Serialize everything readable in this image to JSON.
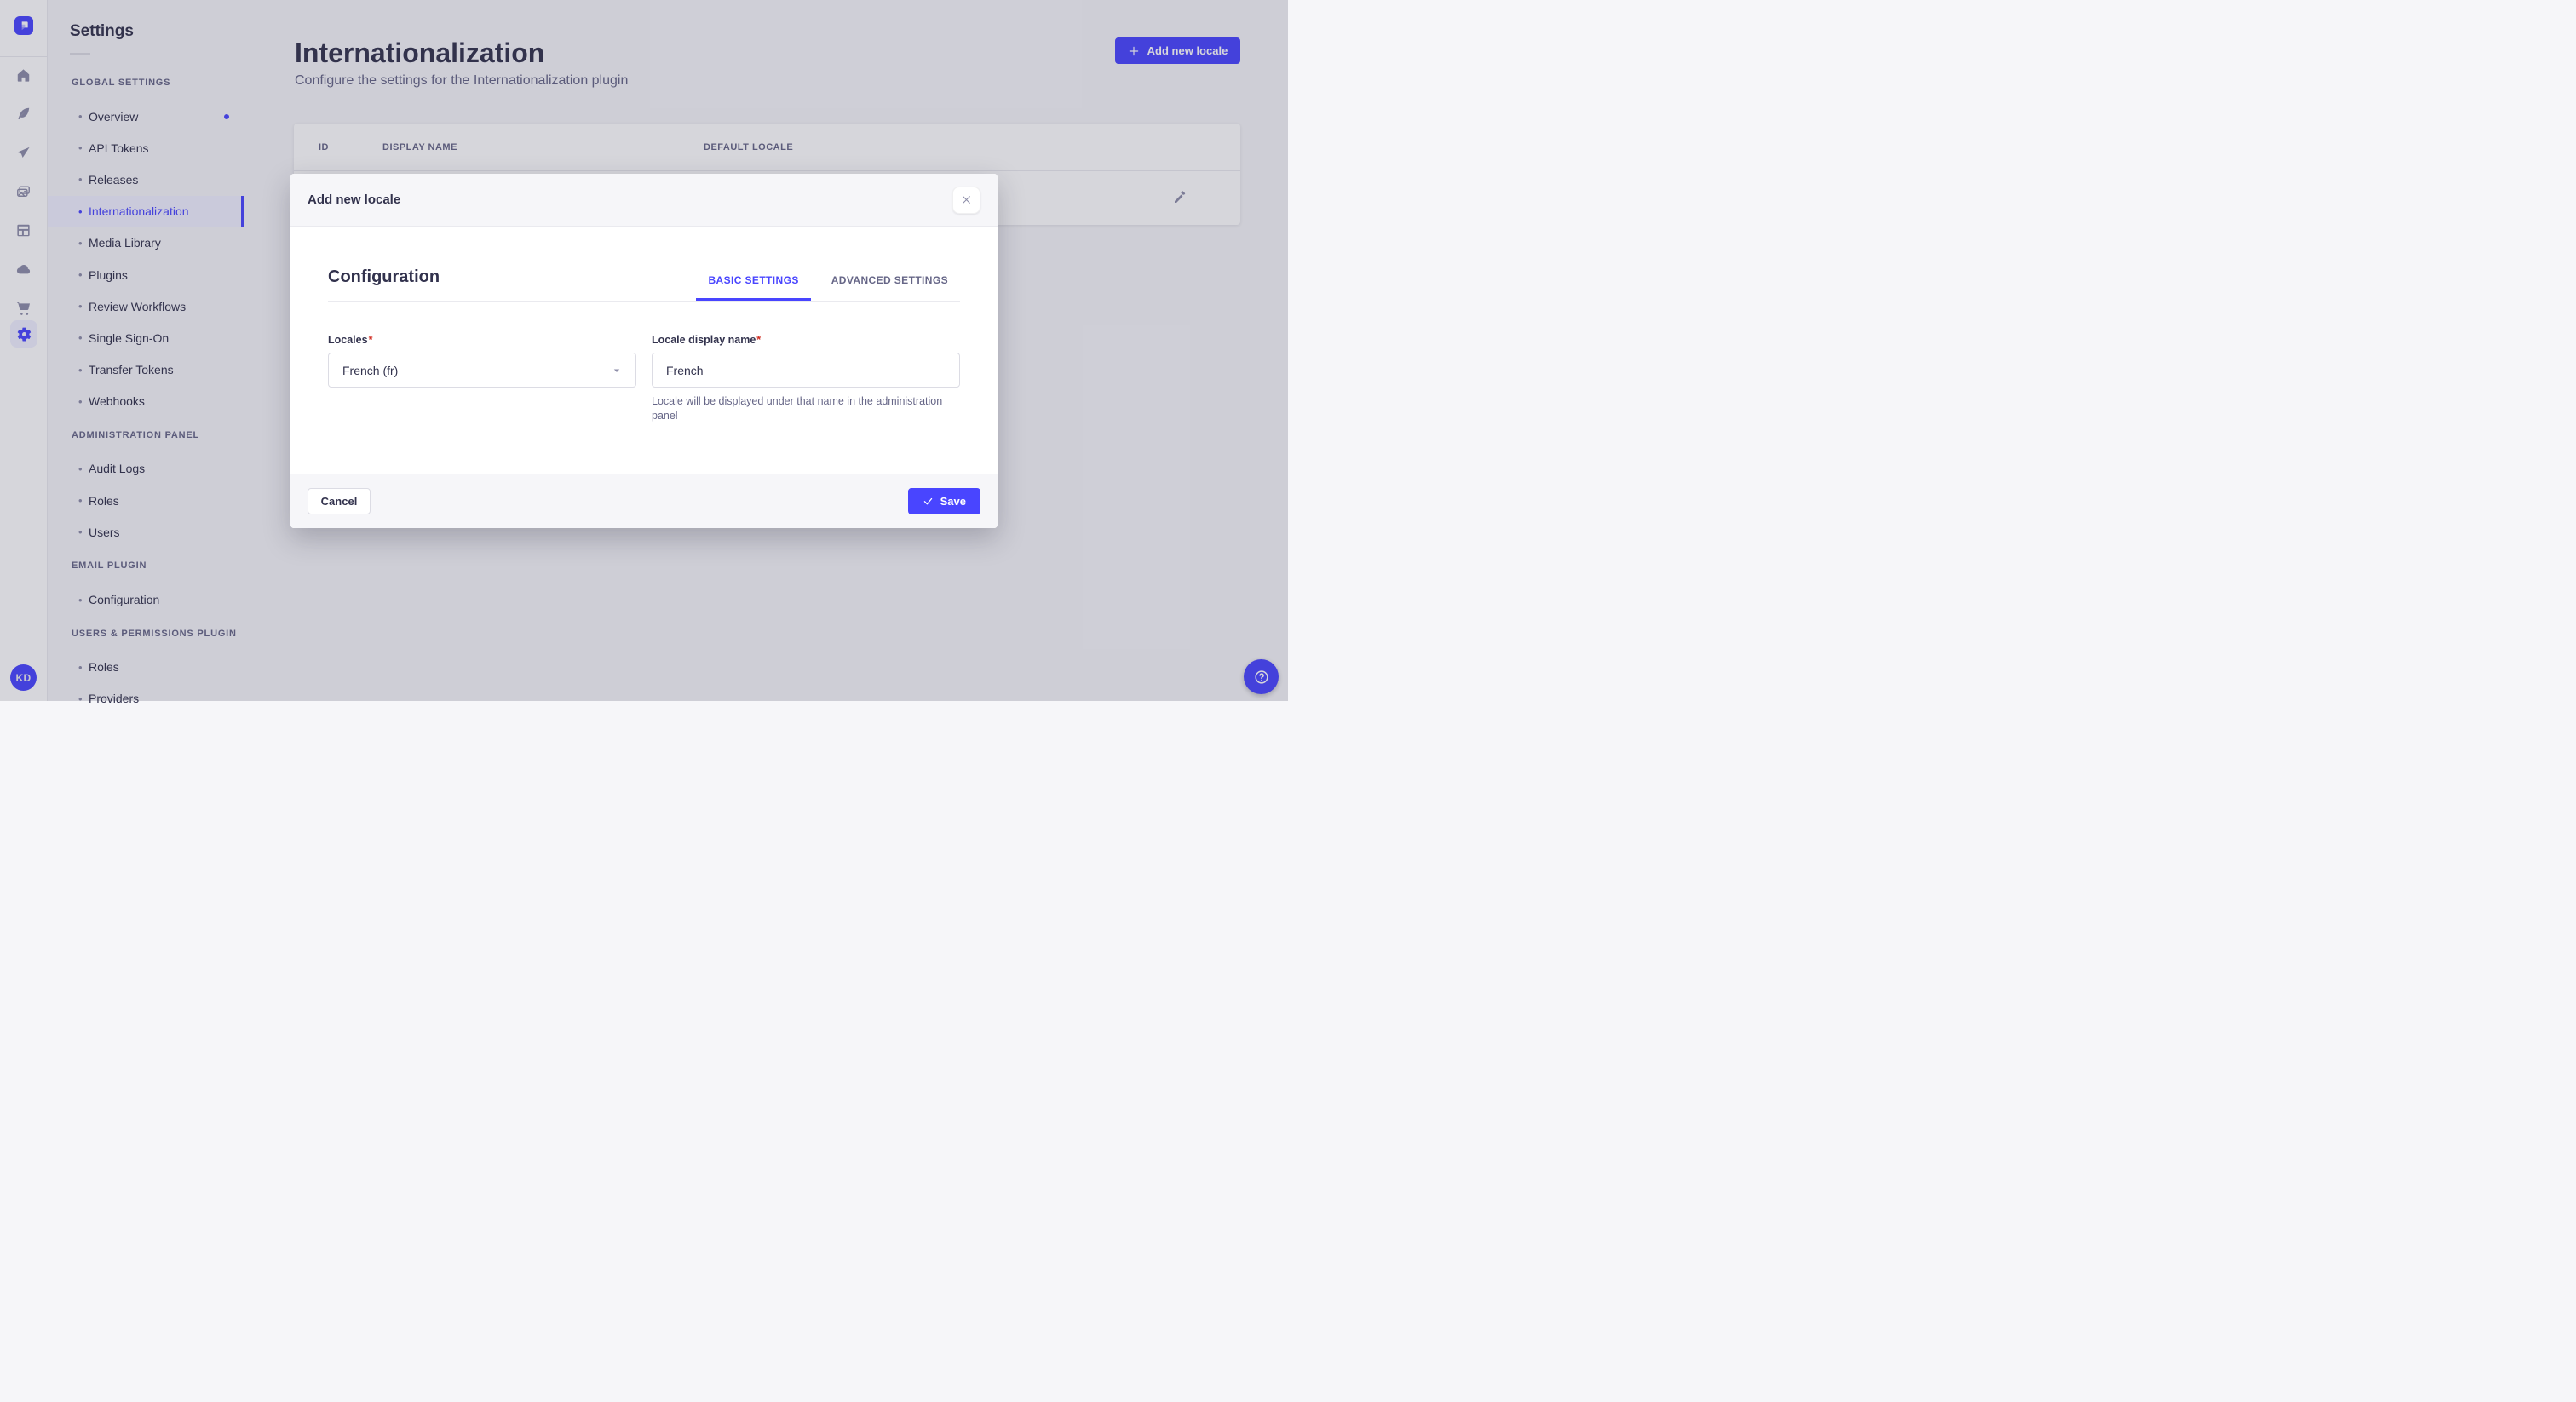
{
  "app": {
    "avatar_initials": "KD",
    "rail_icons": [
      "strapi-logo",
      "home",
      "content-feather",
      "release-paper-plane",
      "media-images",
      "content-manager-layout",
      "cloud",
      "marketplace-cart",
      "settings-gear"
    ],
    "colors": {
      "primary": "#4945ff",
      "text": "#32324d",
      "text_secondary": "#666687",
      "icon_gray": "#8e8ea9",
      "active_bg": "#f0f0ff",
      "surface": "#ffffff",
      "background": "#f6f6f9",
      "required_red": "#d02b20"
    }
  },
  "sidebar": {
    "title": "Settings",
    "sections": [
      {
        "label": "GLOBAL SETTINGS",
        "items": [
          {
            "label": "Overview"
          },
          {
            "label": "API Tokens"
          },
          {
            "label": "Releases"
          },
          {
            "label": "Internationalization"
          },
          {
            "label": "Media Library"
          },
          {
            "label": "Plugins"
          },
          {
            "label": "Review Workflows"
          },
          {
            "label": "Single Sign-On"
          },
          {
            "label": "Transfer Tokens"
          },
          {
            "label": "Webhooks"
          }
        ]
      },
      {
        "label": "ADMINISTRATION PANEL",
        "items": [
          {
            "label": "Audit Logs"
          },
          {
            "label": "Roles"
          },
          {
            "label": "Users"
          }
        ]
      },
      {
        "label": "EMAIL PLUGIN",
        "items": [
          {
            "label": "Configuration"
          }
        ]
      },
      {
        "label": "USERS & PERMISSIONS PLUGIN",
        "items": [
          {
            "label": "Roles"
          },
          {
            "label": "Providers"
          }
        ]
      }
    ]
  },
  "header": {
    "title": "Internationalization",
    "subtitle": "Configure the settings for the Internationalization plugin",
    "add_button_label": "Add new locale"
  },
  "table": {
    "columns": [
      "ID",
      "DISPLAY NAME",
      "DEFAULT LOCALE"
    ]
  },
  "modal": {
    "title": "Add new locale",
    "section_title": "Configuration",
    "required_mark": "*",
    "tabs": [
      {
        "label": "BASIC SETTINGS"
      },
      {
        "label": "ADVANCED SETTINGS"
      }
    ],
    "fields": {
      "locales": {
        "label": "Locales",
        "value": "French (fr)"
      },
      "display_name": {
        "label": "Locale display name",
        "value": "French",
        "hint": "Locale will be displayed under that name in the administration panel"
      }
    },
    "cancel_label": "Cancel",
    "save_label": "Save"
  }
}
